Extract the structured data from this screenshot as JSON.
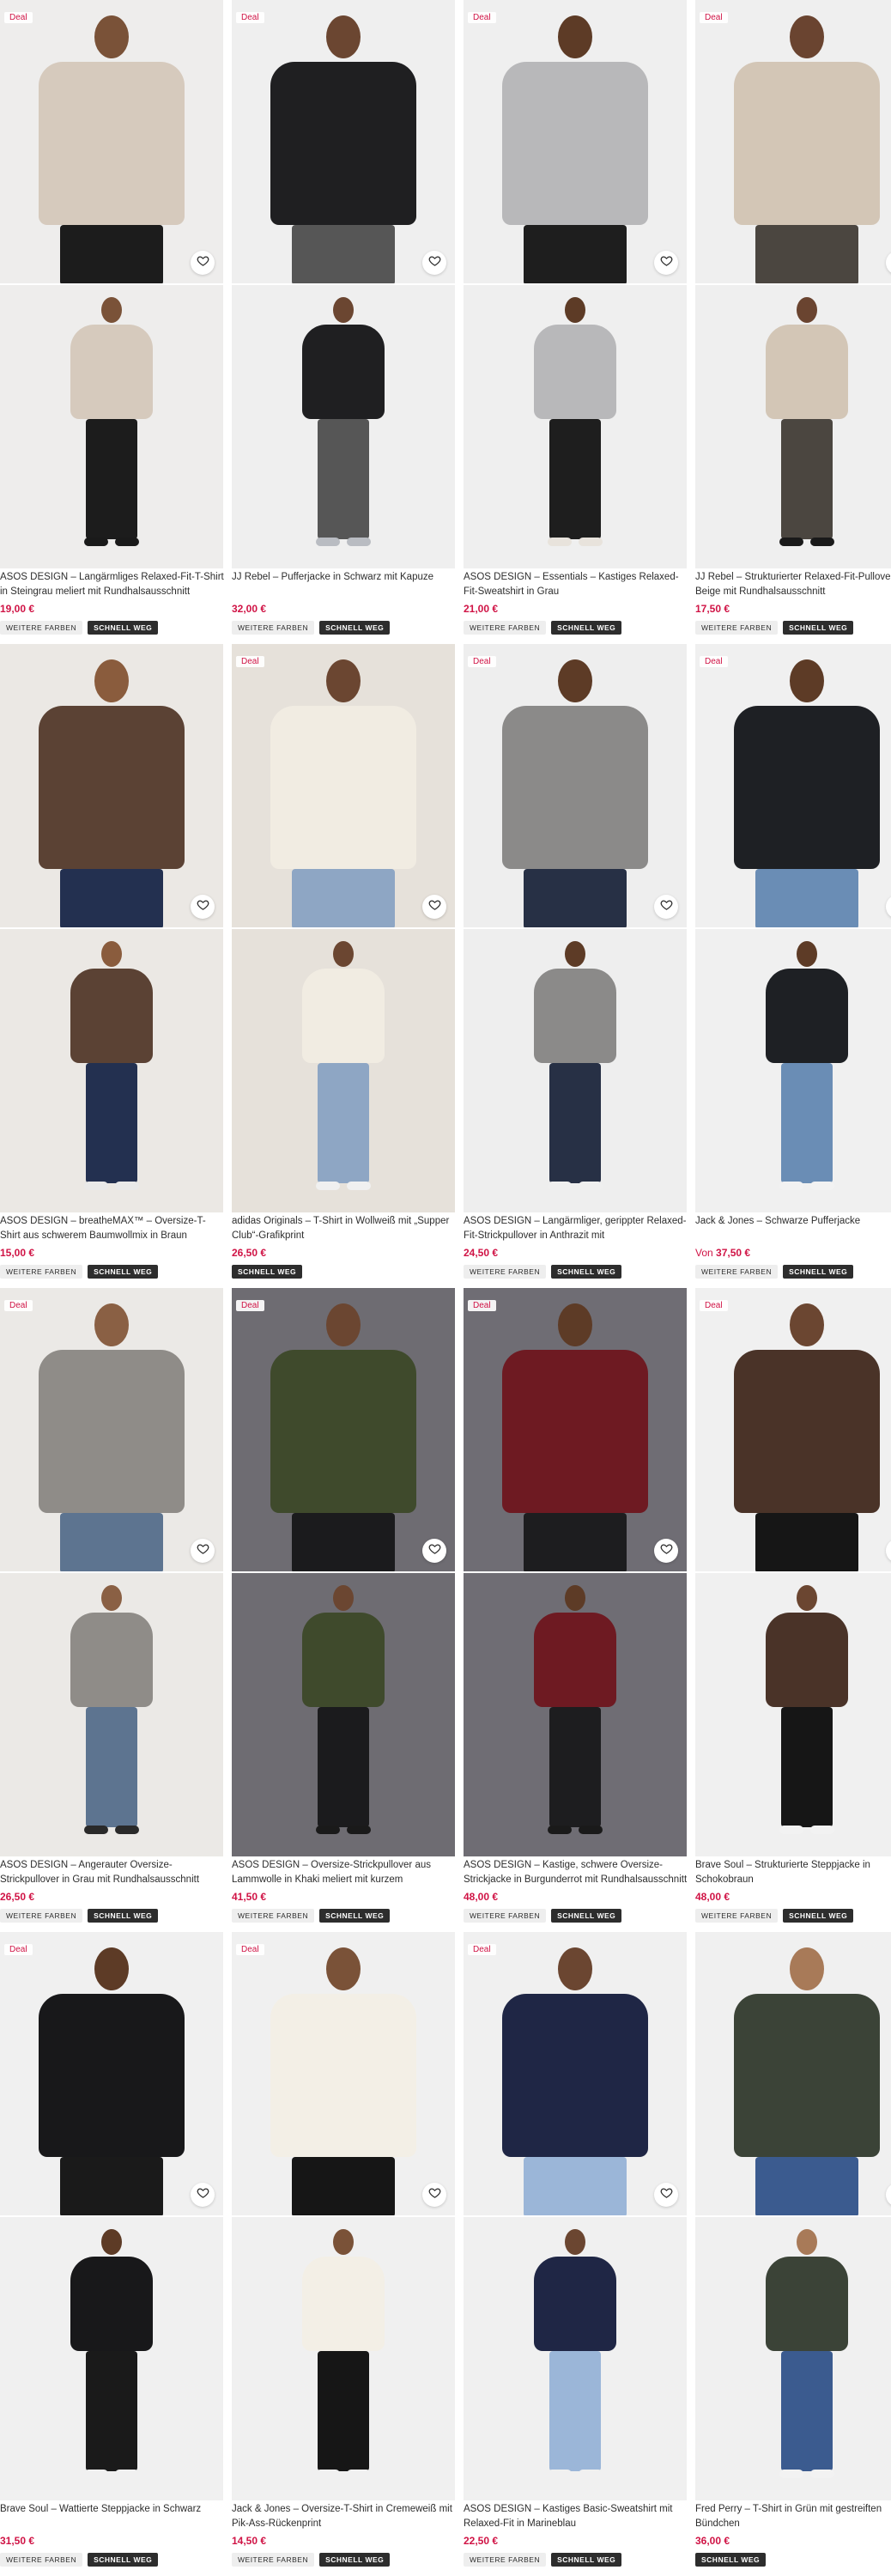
{
  "colors": {
    "price": "#d01345",
    "deal": "#d01345",
    "tag_dark": "#2d2d2d",
    "tag_light": "#eeeeee"
  },
  "labels": {
    "deal": "Deal",
    "more_colors": "WEITERE FARBEN",
    "selling_fast": "SCHNELL WEG",
    "from": "Von"
  },
  "products": [
    {
      "title": "ASOS DESIGN – Langärmliges Relaxed-Fit-T-Shirt in Steingrau meliert mit Rundhalsausschnitt",
      "price": "19,00 €",
      "deal": true,
      "more_colors": true,
      "selling_fast": true,
      "bg": "#eeedec",
      "skin": "#7a5238",
      "top": "#d6cabd",
      "bottom": "#1c1c1c",
      "shoe": "#1a1a1a"
    },
    {
      "title": "JJ Rebel – Pufferjacke in Schwarz mit Kapuze",
      "price": "32,00 €",
      "deal": true,
      "more_colors": true,
      "selling_fast": true,
      "bg": "#efefef",
      "skin": "#6b4631",
      "top": "#1f1f21",
      "bottom": "#565656",
      "shoe": "#b9bcc2"
    },
    {
      "title": "ASOS DESIGN – Essentials – Kastiges Relaxed-Fit-Sweatshirt in Grau",
      "price": "21,00 €",
      "deal": true,
      "more_colors": true,
      "selling_fast": true,
      "bg": "#efefef",
      "skin": "#5d3b26",
      "top": "#b8b8ba",
      "bottom": "#1e1e1e",
      "shoe": "#e8e3dc"
    },
    {
      "title": "JJ Rebel – Strukturierter Relaxed-Fit-Pullover in Beige mit Rundhalsausschnitt",
      "price": "17,50 €",
      "deal": true,
      "more_colors": true,
      "selling_fast": true,
      "bg": "#efefef",
      "skin": "#6a4430",
      "top": "#d3c6b6",
      "bottom": "#4b4640",
      "shoe": "#1a1a1a"
    },
    {
      "title": "ASOS DESIGN – breatheMAX™ – Oversize-T-Shirt aus schwerem Baumwollmix in Braun",
      "price": "15,00 €",
      "deal": false,
      "more_colors": true,
      "selling_fast": true,
      "bg": "#ebe8e4",
      "skin": "#8a5c3d",
      "top": "#5b4234",
      "bottom": "#233050",
      "shoe": "#e9e9e9"
    },
    {
      "title": "adidas Originals – T-Shirt in Wollweiß mit „Supper Club“-Grafikprint",
      "price": "26,50 €",
      "deal": true,
      "more_colors": false,
      "selling_fast": true,
      "bg": "#e6e1da",
      "skin": "#6b4631",
      "top": "#f1ece2",
      "bottom": "#8ea6c4",
      "shoe": "#f0f0f0"
    },
    {
      "title": "ASOS DESIGN – Langärmliger, gerippter Relaxed-Fit-Strickpullover in Anthrazit mit Rundhalsausschnitt",
      "price": "24,50 €",
      "deal": true,
      "more_colors": true,
      "selling_fast": true,
      "bg": "#eeeeee",
      "skin": "#5d3b26",
      "top": "#8b8a89",
      "bottom": "#273045",
      "shoe": "#efefef"
    },
    {
      "title": "Jack & Jones – Schwarze Pufferjacke",
      "price": "37,50 €",
      "from_price": true,
      "deal": true,
      "more_colors": true,
      "selling_fast": true,
      "bg": "#f0f0f0",
      "skin": "#5d3b26",
      "top": "#1e2024",
      "bottom": "#6a8db5",
      "shoe": "#f2f2f2"
    },
    {
      "title": "ASOS DESIGN – Angerauter Oversize-Strickpullover in Grau mit Rundhalsausschnitt",
      "price": "26,50 €",
      "deal": true,
      "more_colors": true,
      "selling_fast": true,
      "bg": "#ebe9e6",
      "skin": "#8a6044",
      "top": "#8f8c88",
      "bottom": "#5d7490",
      "shoe": "#2a2a2a"
    },
    {
      "title": "ASOS DESIGN – Oversize-Strickpullover aus Lammwolle in Khaki meliert mit kurzem Reißverschluss",
      "price": "41,50 €",
      "deal": true,
      "more_colors": true,
      "selling_fast": true,
      "bg": "#6e6c72",
      "skin": "#6b4631",
      "top": "#3f4a2c",
      "bottom": "#1b1b1d",
      "shoe": "#1a1a1a"
    },
    {
      "title": "ASOS DESIGN – Kastige, schwere Oversize-Strickjacke in Burgunderrot mit Rundhalsausschnitt",
      "price": "48,00 €",
      "deal": true,
      "more_colors": true,
      "selling_fast": true,
      "bg": "#6f6d74",
      "skin": "#5d3b26",
      "top": "#6e1a22",
      "bottom": "#1d1d1f",
      "shoe": "#1a1a1a"
    },
    {
      "title": "Brave Soul – Strukturierte Steppjacke in Schokobraun",
      "price": "48,00 €",
      "deal": true,
      "more_colors": true,
      "selling_fast": true,
      "bg": "#f0f0f0",
      "skin": "#6b4631",
      "top": "#4a3328",
      "bottom": "#161616",
      "shoe": "#f2f2f2"
    },
    {
      "title": "Brave Soul – Wattierte Steppjacke in Schwarz",
      "price": "31,50 €",
      "deal": true,
      "more_colors": true,
      "selling_fast": true,
      "bg": "#f0f0f0",
      "skin": "#5d3b26",
      "top": "#18181a",
      "bottom": "#1a1a1a",
      "shoe": "#f0f0f0"
    },
    {
      "title": "Jack & Jones – Oversize-T-Shirt in Cremeweiß mit Pik-Ass-Rückenprint",
      "price": "14,50 €",
      "deal": true,
      "more_colors": true,
      "selling_fast": true,
      "bg": "#f0f0f0",
      "skin": "#7a5238",
      "top": "#f3efe6",
      "bottom": "#161616",
      "shoe": "#f0f0f0"
    },
    {
      "title": "ASOS DESIGN – Kastiges Basic-Sweatshirt mit Relaxed-Fit in Marineblau",
      "price": "22,50 €",
      "deal": true,
      "more_colors": true,
      "selling_fast": true,
      "bg": "#f0f0f0",
      "skin": "#6b4631",
      "top": "#1f2645",
      "bottom": "#9bb6d8",
      "shoe": "#f0f0f0"
    },
    {
      "title": "Fred Perry – T-Shirt in Grün mit gestreiften Bündchen",
      "price": "36,00 €",
      "deal": false,
      "more_colors": false,
      "selling_fast": true,
      "bg": "#f0f0f0",
      "skin": "#a87a58",
      "top": "#3b4337",
      "bottom": "#3b5b8f",
      "shoe": "#f2f2f2"
    }
  ]
}
